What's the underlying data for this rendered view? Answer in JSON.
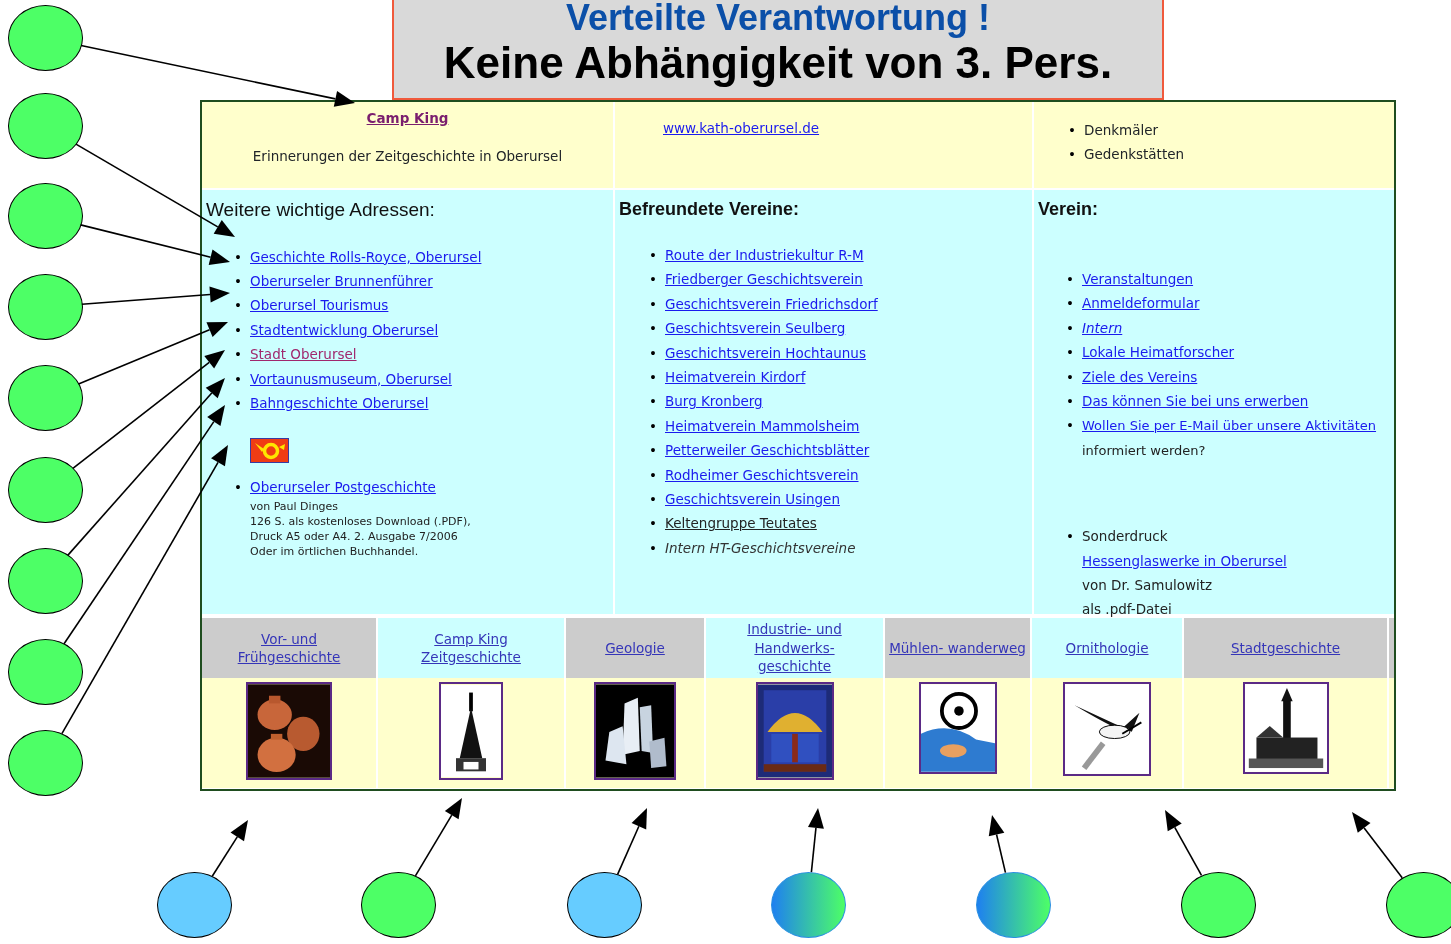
{
  "slide_title": {
    "line_1": "Verteilte Verantwortung !",
    "line_2": "Keine Abhängigkeit von 3. Pers."
  },
  "website": {
    "bullet": "•",
    "top_row": {
      "camp_link": "Camp King",
      "camp_text": "Erinnerungen der Zeitgeschichte in Oberursel",
      "church_link": "www.kath-oberursel.de",
      "bullets": [
        "Denkmäler",
        "Gedenkstätten"
      ]
    },
    "columns": [
      {
        "heading": "Weitere wichtige Adressen:",
        "items": [
          {
            "kind": "link",
            "text": "Geschichte Rolls-Royce, Oberursel"
          },
          {
            "kind": "link",
            "text": "Oberurseler Brunnenführer"
          },
          {
            "kind": "link",
            "text": "Oberursel Tourismus"
          },
          {
            "kind": "link",
            "text": "Stadtentwicklung Oberursel"
          },
          {
            "kind": "visited",
            "text": "Stadt Oberursel"
          },
          {
            "kind": "link",
            "text": "Vortaunusmuseum, Oberursel"
          },
          {
            "kind": "link",
            "text": "Bahngeschichte Oberursel"
          },
          {
            "kind": "post",
            "text": "Oberurseler Postgeschichte",
            "lines": [
              "von Paul Dinges",
              "126 S. als kostenloses Download (.PDF),",
              "Druck A5 oder A4. 2. Ausgabe 7/2006",
              "Oder im örtlichen Buchhandel."
            ]
          }
        ]
      },
      {
        "heading": "Befreundete Vereine:",
        "items": [
          {
            "kind": "link",
            "text": "Route der Industriekultur R-M"
          },
          {
            "kind": "link",
            "text": "Friedberger Geschichtsverein"
          },
          {
            "kind": "link",
            "text": "Geschichtsverein Friedrichsdorf"
          },
          {
            "kind": "link",
            "text": "Geschichtsverein Seulberg"
          },
          {
            "kind": "link",
            "text": "Geschichtsverein Hochtaunus"
          },
          {
            "kind": "link",
            "text": "Heimatverein Kirdorf"
          },
          {
            "kind": "link",
            "text": "Burg Kronberg"
          },
          {
            "kind": "link",
            "text": "Heimatverein Mammolsheim"
          },
          {
            "kind": "link",
            "text": "Petterweiler Geschichtsblätter"
          },
          {
            "kind": "link",
            "text": "Rodheimer Geschichtsverein"
          },
          {
            "kind": "link",
            "text": "Geschichtsverein Usingen"
          },
          {
            "kind": "dark-link",
            "text": "Keltengruppe Teutates"
          },
          {
            "kind": "italic-text",
            "text": "Intern HT-Geschichtsvereine"
          }
        ]
      },
      {
        "heading": "Verein:",
        "items": [
          {
            "kind": "link",
            "text": "Veranstaltungen"
          },
          {
            "kind": "link",
            "text": "Anmeldeformular"
          },
          {
            "kind": "italic-link",
            "text": "Intern"
          },
          {
            "kind": "link",
            "text": "Lokale Heimatforscher"
          },
          {
            "kind": "link",
            "text": "Ziele des Vereins"
          },
          {
            "kind": "link",
            "text": "Das können Sie bei uns erwerben"
          },
          {
            "kind": "mixed",
            "text": "Wollen Sie per E-Mail über unsere Aktivitäten",
            "rest": "informiert werden?"
          },
          {
            "kind": "print",
            "label": "Sonderdruck",
            "text": "Hessenglaswerke in Oberursel",
            "lines": [
              "von Dr. Samulowitz",
              "als .pdf-Datei"
            ]
          }
        ]
      }
    ],
    "topics": [
      {
        "label": "Vor- und Frühgeschichte",
        "kind": "picture"
      },
      {
        "label": "Camp King Zeitgeschichte",
        "kind": "picture"
      },
      {
        "label": "Geologie",
        "kind": "picture"
      },
      {
        "label": "Industrie- und Handwerks- geschichte",
        "kind": "picture"
      },
      {
        "label": "Mühlen- wanderweg",
        "kind": "picture"
      },
      {
        "label": "Ornithologie",
        "kind": "picture"
      },
      {
        "label": "Stadtgeschichte",
        "kind": "picture"
      }
    ]
  },
  "left_markers": [
    {
      "color": "#4dff66"
    },
    {
      "color": "#4dff66"
    },
    {
      "color": "#4dff66"
    },
    {
      "color": "#4dff66"
    },
    {
      "color": "#4dff66"
    },
    {
      "color": "#4dff66"
    },
    {
      "color": "#4dff66"
    },
    {
      "color": "#4dff66"
    },
    {
      "color": "#4dff66"
    }
  ],
  "bottom_markers": [
    {
      "kind": "solid",
      "color": "#66ccff"
    },
    {
      "kind": "solid",
      "color": "#4dff66"
    },
    {
      "kind": "solid",
      "color": "#66ccff"
    },
    {
      "kind": "gradient"
    },
    {
      "kind": "gradient"
    },
    {
      "kind": "solid",
      "color": "#4dff66"
    },
    {
      "kind": "solid",
      "color": "#4dff66"
    }
  ]
}
